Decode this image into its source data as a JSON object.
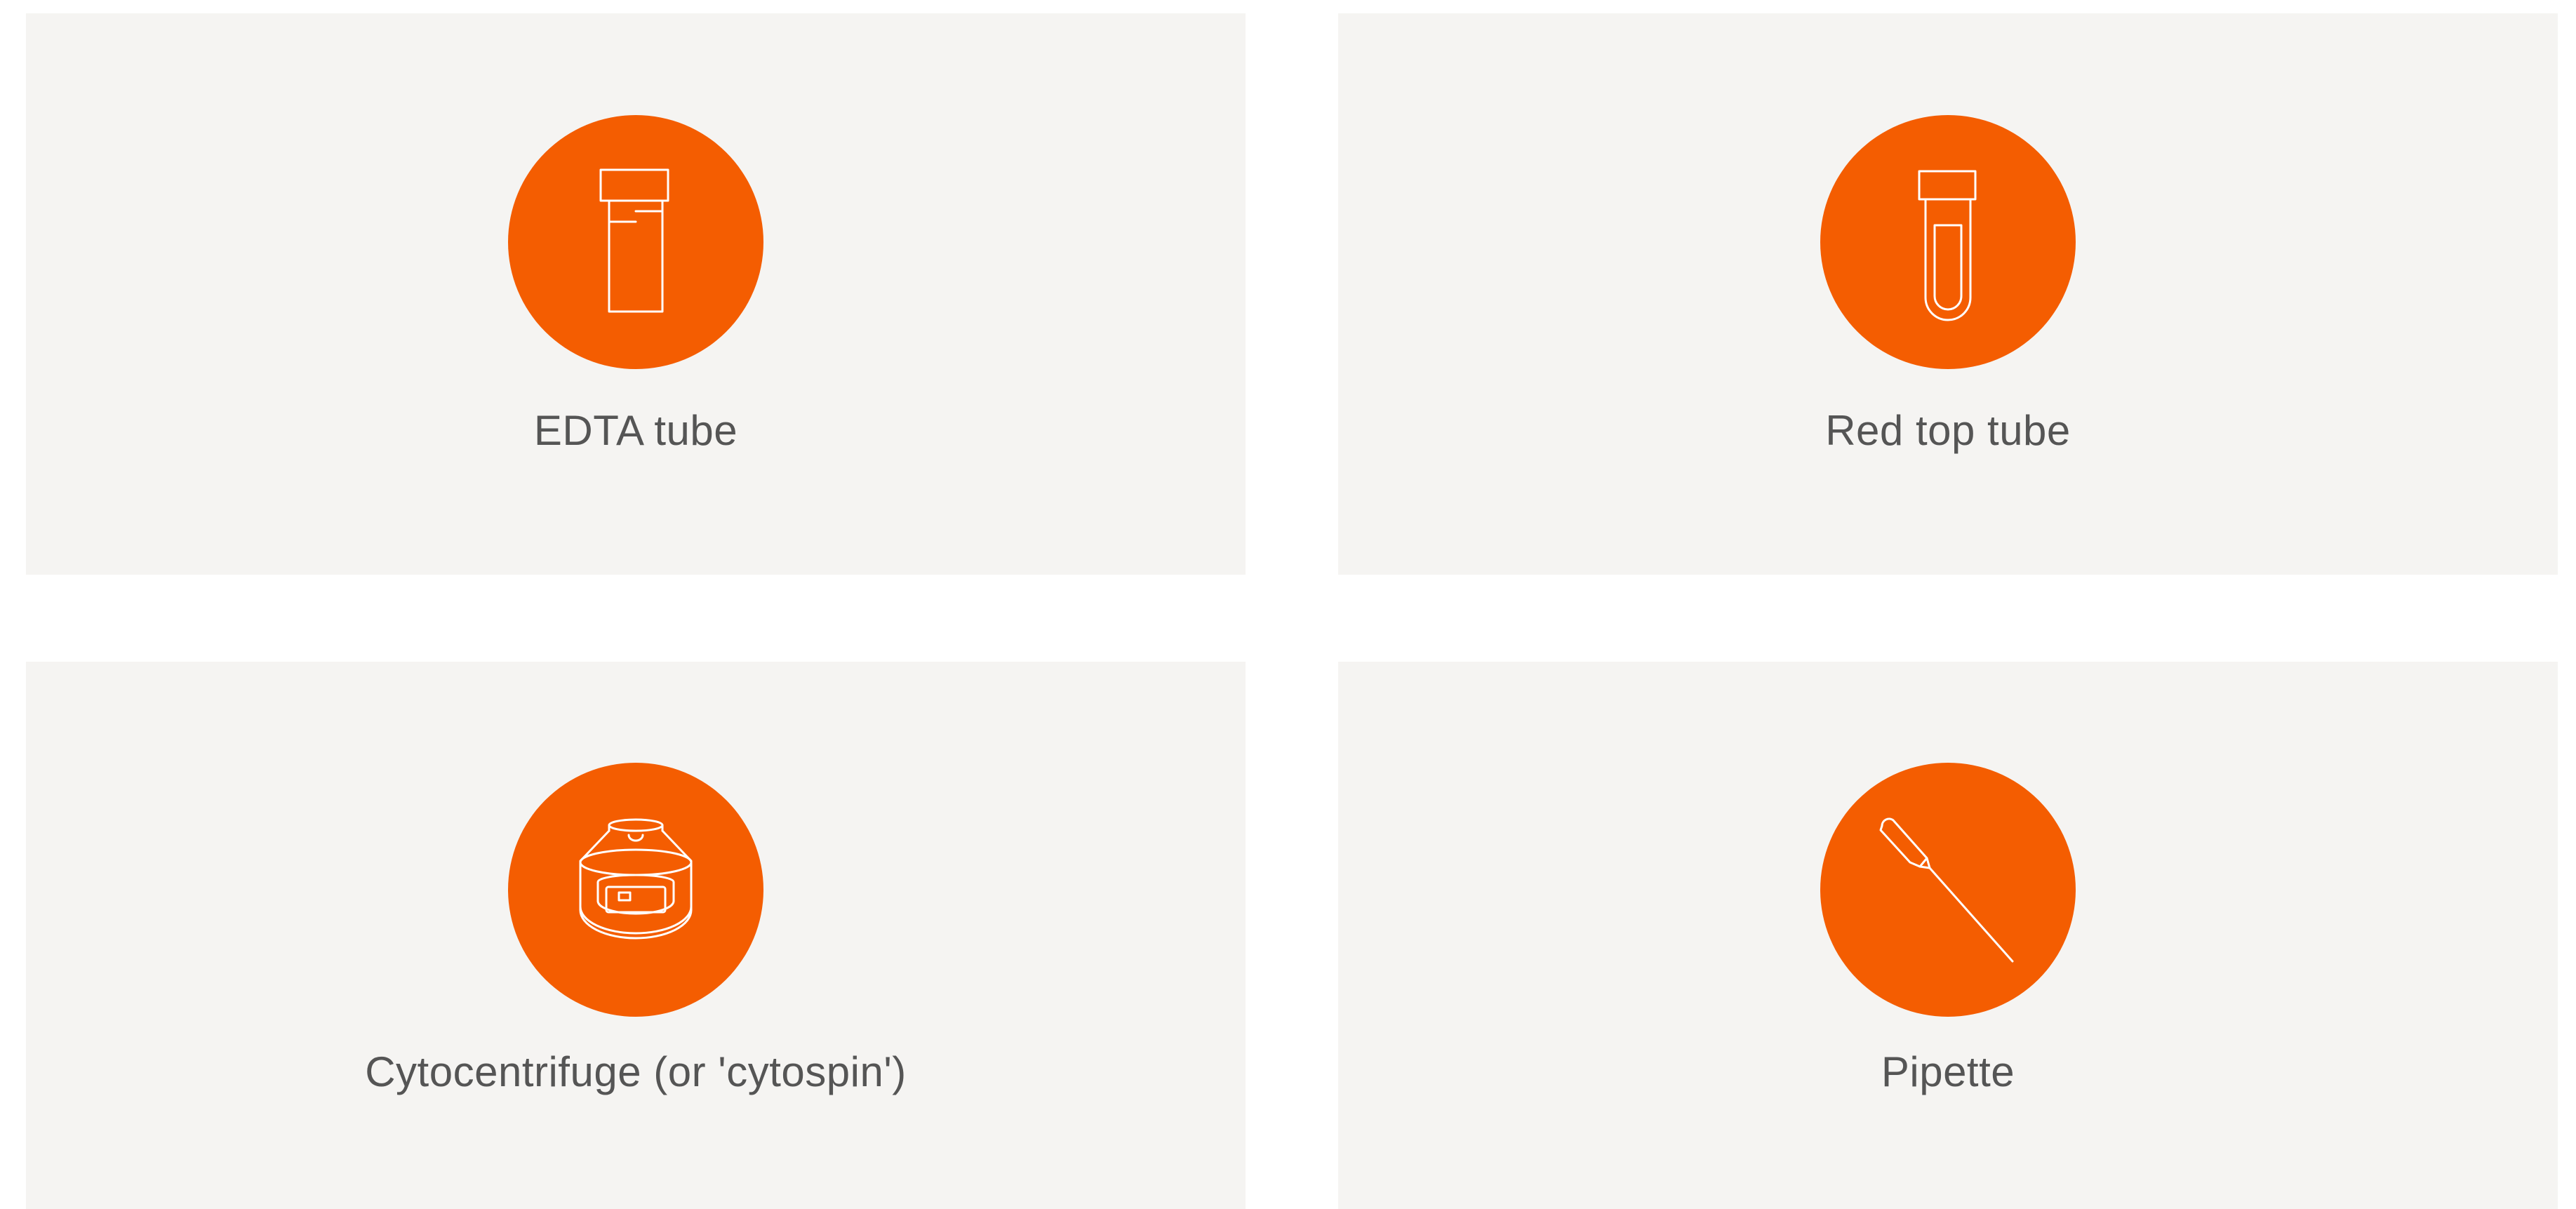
{
  "items": [
    {
      "label": "EDTA tube",
      "icon": "edta-tube-icon"
    },
    {
      "label": "Red top tube",
      "icon": "red-top-tube-icon"
    },
    {
      "label": "Cytocentrifuge (or 'cytospin')",
      "icon": "cytocentrifuge-icon"
    },
    {
      "label": "Pipette",
      "icon": "pipette-icon"
    }
  ],
  "colors": {
    "accent": "#f45d01",
    "card_background": "#f5f4f2",
    "label_text": "#555555",
    "page_background": "#ffffff"
  }
}
